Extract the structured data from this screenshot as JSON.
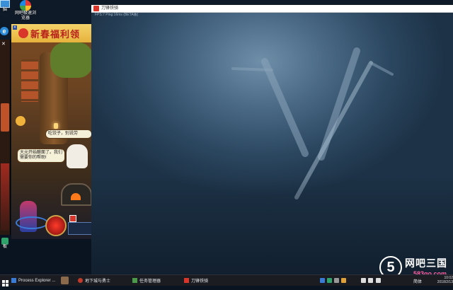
{
  "desktop": {
    "icons": [
      {
        "label": "脑",
        "name": "computer-icon"
      },
      {
        "label": "网吧极速浏",
        "label2": "览器",
        "name": "browser-icon"
      },
      {
        "label": "板",
        "name": "control-panel-icon"
      }
    ]
  },
  "game_panel": {
    "banner": "新春福利领",
    "bubble1": "吃饺子，别说劳",
    "bubble2_line1": "大元开始酿面了。我们",
    "bubble2_line2": "需要你的帮助!"
  },
  "main_window": {
    "title": "刀锋铁骑",
    "fps": "FPS:7  Ping:16ms  (BETA版)"
  },
  "taskbar": {
    "items": [
      {
        "label": "Process Explorer ..."
      },
      {
        "label": "地下城与勇士"
      },
      {
        "label": "任务管理器"
      },
      {
        "label": "刀锋铁骑"
      }
    ],
    "tray_label": "简体",
    "clock_time": "10:02",
    "clock_date": "2018/2/13"
  },
  "watermark": {
    "number": "5",
    "title": "网吧三国",
    "url": "583go.com"
  },
  "colors": {
    "banner_red": "#b8211b",
    "watermark_pink": "#ff5fa0"
  }
}
